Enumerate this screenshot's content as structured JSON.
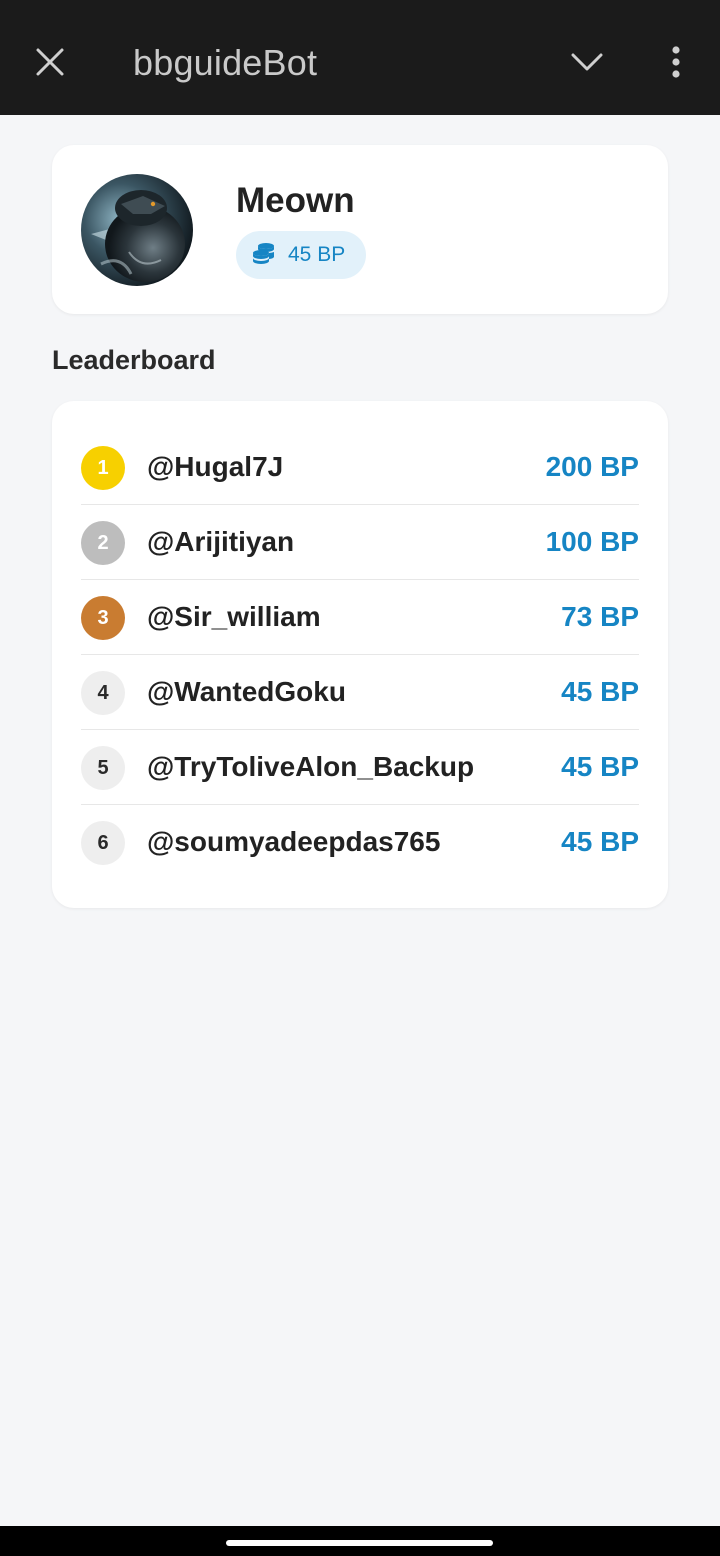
{
  "header": {
    "title": "bbguideBot",
    "close_icon": "close-icon",
    "collapse_icon": "chevron-down-icon",
    "more_icon": "more-vertical-icon"
  },
  "profile": {
    "name": "Meown",
    "points": "45 BP",
    "points_icon": "coins-stack-icon"
  },
  "leaderboard": {
    "title": "Leaderboard",
    "entries": [
      {
        "rank": "1",
        "handle": "@Hugal7J",
        "score": "200 BP",
        "rank_color": "#f7d000"
      },
      {
        "rank": "2",
        "handle": "@Arijitiyan",
        "score": "100 BP",
        "rank_color": "#bdbdbd"
      },
      {
        "rank": "3",
        "handle": "@Sir_william",
        "score": "73 BP",
        "rank_color": "#c97c31"
      },
      {
        "rank": "4",
        "handle": "@WantedGoku",
        "score": "45 BP",
        "rank_color": "#eeeeee"
      },
      {
        "rank": "5",
        "handle": "@TryToliveAlon_Backup",
        "score": "45 BP",
        "rank_color": "#eeeeee"
      },
      {
        "rank": "6",
        "handle": "@soumyadeepdas765",
        "score": "45 BP",
        "rank_color": "#eeeeee"
      }
    ]
  },
  "colors": {
    "accent": "#1685c4",
    "topbar": "#1b1b1b",
    "background": "#f5f6f8"
  }
}
